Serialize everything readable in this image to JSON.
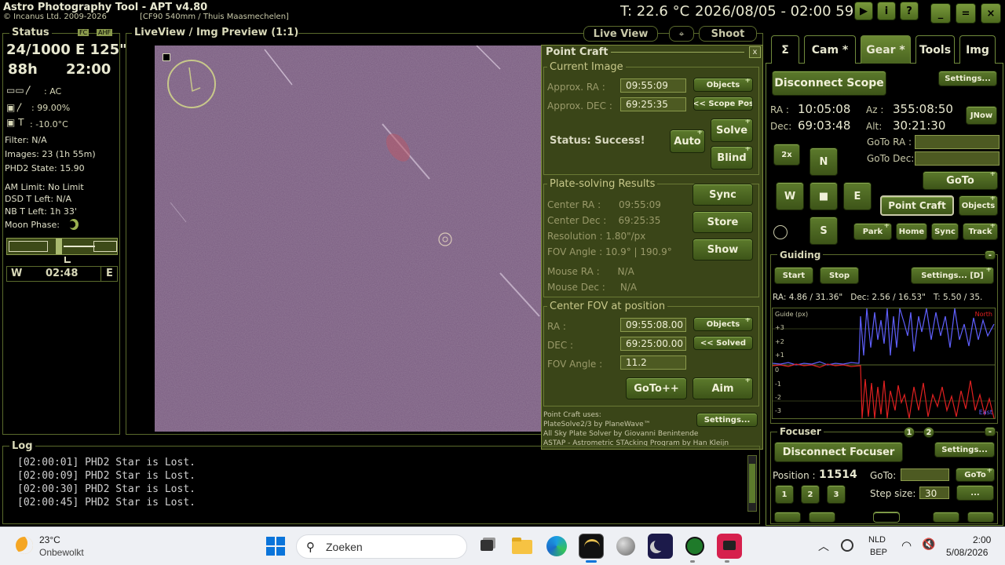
{
  "app": {
    "title": "Astro Photography Tool  -  APT v4.80",
    "copyright": "© Incanus Ltd. 2009-2026",
    "profile": "[CF90 540mm / Thuis Maasmechelen]",
    "temperature": "T: 22.6 °C",
    "datetime": "2026/08/05 - 02:00 59"
  },
  "status": {
    "title": "Status",
    "badge_fc": "FC",
    "badge_ahf": "AHF",
    "frames": "24/1000 E 125\"",
    "hours": "88h",
    "time": "22:00",
    "power": ": AC",
    "battery": ": 99.00%",
    "cam_temp": ": -10.0°C",
    "filter": "Filter: N/A",
    "images": "Images: 23 (1h 55m)",
    "phd2": "PHD2 State: 15.90",
    "am_limit": "AM Limit: No Limit",
    "dsd": "DSD T Left: N/A",
    "nb": "NB T Left: 1h 33'",
    "moon": "Moon Phase:",
    "west": "W",
    "meridian_time": "02:48",
    "east": "E"
  },
  "preview": {
    "title": "LiveView / Img Preview (1:1)",
    "live_view": "Live View",
    "shoot": "Shoot"
  },
  "point_craft": {
    "title": "Point Craft",
    "close": "x",
    "current_image": "Current Image",
    "approx_ra_label": "Approx. RA :",
    "approx_ra": "09:55:09",
    "approx_dec_label": "Approx. DEC :",
    "approx_dec": "69:25:35",
    "objects": "Objects",
    "scope_pos": "<< Scope Pos",
    "status": "Status: Success!",
    "auto": "Auto",
    "solve": "Solve",
    "blind": "Blind",
    "results_title": "Plate-solving Results",
    "center_ra": "Center RA :      09:55:09",
    "center_dec": "Center Dec :    69:25:35",
    "resolution": "Resolution : 1.80\"/px",
    "fov_angle": "FOV Angle : 10.9° | 190.9°",
    "sync": "Sync",
    "store": "Store",
    "show": "Show",
    "mouse_ra": "Mouse RA :      N/A",
    "mouse_dec": "Mouse Dec :     N/A",
    "center_fov_title": "Center FOV at position",
    "ra_label": "RA :",
    "ra_value": "09:55:08.00",
    "dec_label": "DEC :",
    "dec_value": "69:25:00.00",
    "objects2": "Objects",
    "solved": "<< Solved",
    "fov_angle_label": "FOV Angle :",
    "fov_angle_value": "11.2",
    "goto_pp": "GoTo++",
    "aim": "Aim",
    "uses_1": "Point Craft uses:",
    "uses_2": "PlateSolve2/3 by PlaneWave™",
    "uses_3": "All Sky Plate Solver by Giovanni Benintende",
    "uses_4": "ASTAP - Astrometric STAcking Program by Han Kleijn",
    "settings": "Settings..."
  },
  "tabs": [
    {
      "label": "Σ"
    },
    {
      "label": "Cam *"
    },
    {
      "label": "Gear *"
    },
    {
      "label": "Tools"
    },
    {
      "label": "Img"
    }
  ],
  "gear": {
    "disconnect_scope": "Disconnect Scope",
    "settings": "Settings...",
    "ra_label": "RA :",
    "ra": "10:05:08",
    "dec_label": "Dec:",
    "dec": "69:03:48",
    "az_label": "Az :",
    "az": "355:08:50",
    "alt_label": "Alt:",
    "alt": "30:21:30",
    "jnow": "JNow",
    "goto_ra": "GoTo RA :",
    "goto_dec": "GoTo Dec:",
    "rate": "2x",
    "n": "N",
    "w": "W",
    "stop": "■",
    "e": "E",
    "s": "S",
    "goto": "GoTo",
    "point_craft": "Point Craft",
    "objects": "Objects",
    "park": "Park",
    "home": "Home",
    "sync": "Sync",
    "track": "Track"
  },
  "guiding": {
    "title": "Guiding",
    "start": "Start",
    "stop": "Stop",
    "settings": "Settings... [D]",
    "stats": "RA: 4.86 / 31.36\"   Dec: 2.56 / 16.53\"   T: 5.50 / 35.",
    "axis_title": "Guide (px)",
    "north": "North",
    "east": "East",
    "ticks": [
      "+3",
      "+2",
      "+1",
      "0",
      "-1",
      "-2",
      "-3"
    ]
  },
  "focuser": {
    "title": "Focuser",
    "tab1": "1",
    "tab2": "2",
    "disconnect": "Disconnect Focuser",
    "settings": "Settings...",
    "position_label": "Position :",
    "position": "11514",
    "goto_label": "GoTo:",
    "goto_btn": "GoTo",
    "step_label": "Step size:",
    "step": "30",
    "more": "...",
    "b1": "1",
    "b2": "2",
    "b3": "3"
  },
  "log": {
    "title": "Log",
    "lines": [
      "[02:00:01] PHD2 Star is Lost.",
      "[02:00:09] PHD2 Star is Lost.",
      "[02:00:30] PHD2 Star is Lost.",
      "[02:00:45] PHD2 Star is Lost."
    ]
  },
  "taskbar": {
    "weather_temp": "23°C",
    "weather_desc": "Onbewolkt",
    "search": "Zoeken",
    "lang_1": "NLD",
    "lang_2": "BEP",
    "time": "2:00",
    "date": "5/08/2026"
  },
  "colors": {
    "accent_green": "#5c7a2c",
    "image_bg": "#7a5e80",
    "guide_ra": "#6060ff",
    "guide_dec": "#e02020"
  }
}
